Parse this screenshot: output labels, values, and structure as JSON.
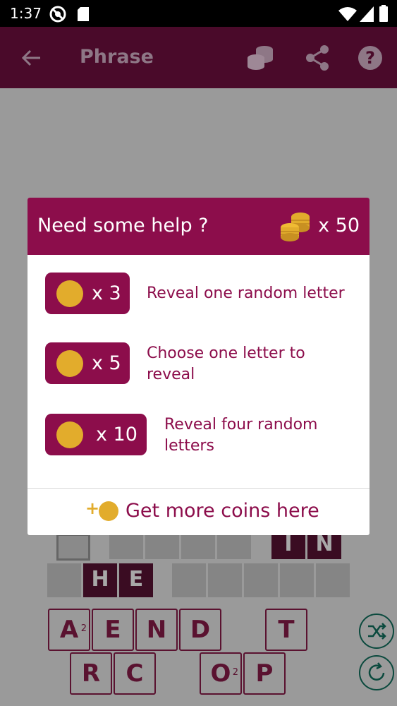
{
  "status_bar": {
    "time": "1:37"
  },
  "app_bar": {
    "title": "Phrase"
  },
  "dialog": {
    "title": "Need some help ?",
    "coin_balance": "x 50",
    "options": [
      {
        "cost": "x 3",
        "label": "Reveal one random letter"
      },
      {
        "cost": "x 5",
        "label": "Choose one letter to reveal"
      },
      {
        "cost": "x 10",
        "label": "Reveal four random letters"
      }
    ],
    "more_coins_plus": "+",
    "more_coins_label": "Get more coins here"
  },
  "board": {
    "row1_letters": [
      "I",
      "N"
    ],
    "row2_letters": [
      "H",
      "E"
    ]
  },
  "letter_tiles": [
    {
      "letter": "A",
      "sub": "2"
    },
    {
      "letter": "E",
      "sub": ""
    },
    {
      "letter": "N",
      "sub": ""
    },
    {
      "letter": "D",
      "sub": ""
    },
    {
      "letter": "T",
      "sub": ""
    },
    {
      "letter": "R",
      "sub": ""
    },
    {
      "letter": "C",
      "sub": ""
    },
    {
      "letter": "O",
      "sub": "2"
    },
    {
      "letter": "P",
      "sub": ""
    }
  ],
  "colors": {
    "primary": "#8c0d4b",
    "coin": "#e2ac2c",
    "app_bar_dimmed": "#4a0a2a",
    "accent_green": "#0b4a3e"
  }
}
